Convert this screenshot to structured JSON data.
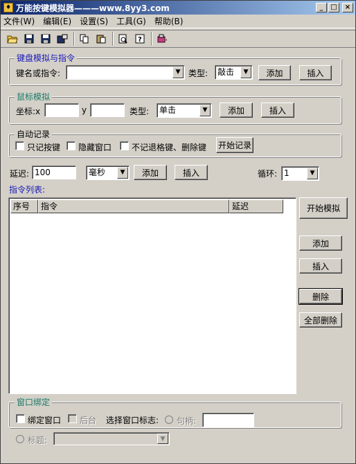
{
  "window": {
    "title": "万能按键模拟器———www.8yy3.com",
    "minimize_label": "_",
    "maximize_label": "□",
    "close_label": "×"
  },
  "menu": [
    {
      "label": "文件(W)"
    },
    {
      "label": "编辑(E)"
    },
    {
      "label": "设置(S)"
    },
    {
      "label": "工具(G)"
    },
    {
      "label": "帮助(B)"
    }
  ],
  "toolbar": {
    "icons": [
      "open-folder-icon",
      "save-icon",
      "save-as-icon",
      "properties-icon",
      "copy-icon",
      "paste-icon",
      "print-preview-icon",
      "help-icon",
      "tool-icon"
    ]
  },
  "keyboard_group": {
    "legend": "键盘模拟与指令",
    "key_label": "键名或指令:",
    "key_value": "",
    "type_label": "类型:",
    "type_value": "敲击",
    "add_label": "添加",
    "insert_label": "插入"
  },
  "mouse_group": {
    "legend": "鼠标模拟",
    "coord_label": "坐标:x",
    "x_value": "",
    "y_label": "y",
    "y_value": "",
    "type_label": "类型:",
    "type_value": "单击",
    "add_label": "添加",
    "insert_label": "插入"
  },
  "record_group": {
    "legend": "自动记录",
    "only_keys_label": "只记按键",
    "hide_window_label": "隐藏窗口",
    "no_backspace_label": "不记退格键、删除键",
    "start_label": "开始记录"
  },
  "delay": {
    "label": "延迟:",
    "value": "100",
    "unit": "毫秒",
    "add_label": "添加",
    "insert_label": "插入",
    "loop_label": "循环:",
    "loop_value": "1"
  },
  "list": {
    "title": "指令列表:",
    "columns": [
      "序号",
      "指令",
      "延迟"
    ]
  },
  "side_buttons": {
    "start": "开始模拟",
    "add": "添加",
    "insert": "插入",
    "delete": "删除",
    "delete_all": "全部删除"
  },
  "window_bind": {
    "legend": "窗口绑定",
    "bind_label": "绑定窗口",
    "background_label": "后台",
    "select_label": "选择窗口标志:",
    "handle_label": "句柄:",
    "handle_value": "",
    "title_label": "标题:",
    "title_value": ""
  }
}
